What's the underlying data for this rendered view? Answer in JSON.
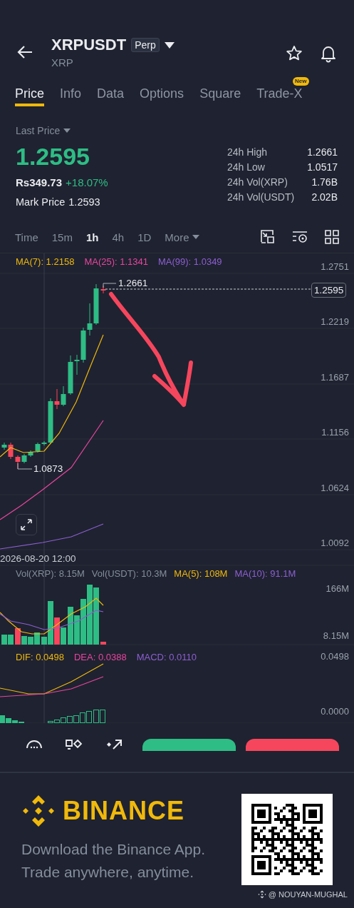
{
  "header": {
    "title": "XRPUSDT",
    "badge": "Perp",
    "subtitle": "XRP"
  },
  "tabs": [
    {
      "label": "Price",
      "selected": true
    },
    {
      "label": "Info",
      "selected": false
    },
    {
      "label": "Data",
      "selected": false
    },
    {
      "label": "Options",
      "selected": false
    },
    {
      "label": "Square",
      "selected": false
    },
    {
      "label": "Trade-X",
      "selected": false,
      "badge": "New"
    }
  ],
  "price": {
    "label": "Last Price",
    "last": "1.2595",
    "fiat": "Rs349.73",
    "change": "+18.07%",
    "mark_label": "Mark Price",
    "mark": "1.2593"
  },
  "stats": [
    {
      "label": "24h High",
      "value": "1.2661"
    },
    {
      "label": "24h Low",
      "value": "1.0517"
    },
    {
      "label": "24h Vol(XRP)",
      "value": "1.76B"
    },
    {
      "label": "24h Vol(USDT)",
      "value": "2.02B"
    }
  ],
  "intervals": [
    {
      "label": "Time",
      "kind": "option",
      "selected": false
    },
    {
      "label": "15m",
      "kind": "option",
      "selected": false
    },
    {
      "label": "1h",
      "kind": "option",
      "selected": true
    },
    {
      "label": "4h",
      "kind": "option",
      "selected": false
    },
    {
      "label": "1D",
      "kind": "option",
      "selected": false
    },
    {
      "label": "More",
      "kind": "menu",
      "selected": false
    }
  ],
  "chart": {
    "ma_legend": [
      {
        "text": "MA(7): 1.2158",
        "color": "#f0b90b"
      },
      {
        "text": "MA(25): 1.1341",
        "color": "#e8469f"
      },
      {
        "text": "MA(99): 1.0349",
        "color": "#8d5fd3"
      }
    ],
    "price_axis": [
      "1.2751",
      "1.2219",
      "1.1687",
      "1.1156",
      "1.0624",
      "1.0092"
    ],
    "high_label": "1.2661",
    "low_label": "1.0873",
    "current_price": "1.2595",
    "crosshair_time": "2026-08-20 12:00"
  },
  "volume": {
    "legend": [
      {
        "text": "Vol(XRP): 8.15M",
        "color": "#848e9c"
      },
      {
        "text": "Vol(USDT): 10.3M",
        "color": "#848e9c"
      },
      {
        "text": "MA(5): 108M",
        "color": "#f0b90b"
      },
      {
        "text": "MA(10): 91.1M",
        "color": "#8d5fd3"
      }
    ],
    "axis": [
      "166M",
      "8.15M"
    ]
  },
  "macd": {
    "legend": [
      {
        "text": "DIF: 0.0498",
        "color": "#f0b90b"
      },
      {
        "text": "DEA: 0.0388",
        "color": "#e8469f"
      },
      {
        "text": "MACD: 0.0110",
        "color": "#8d5fd3"
      }
    ],
    "axis": [
      "0.0498",
      "0.0000"
    ]
  },
  "actions": [
    {
      "kind": "buy"
    },
    {
      "kind": "sell"
    }
  ],
  "banner": {
    "brand": "BINANCE",
    "lines": [
      "Download the Binance App.",
      "Trade anywhere, anytime."
    ],
    "credit": "@ NOUYAN-MUGHAL"
  }
}
